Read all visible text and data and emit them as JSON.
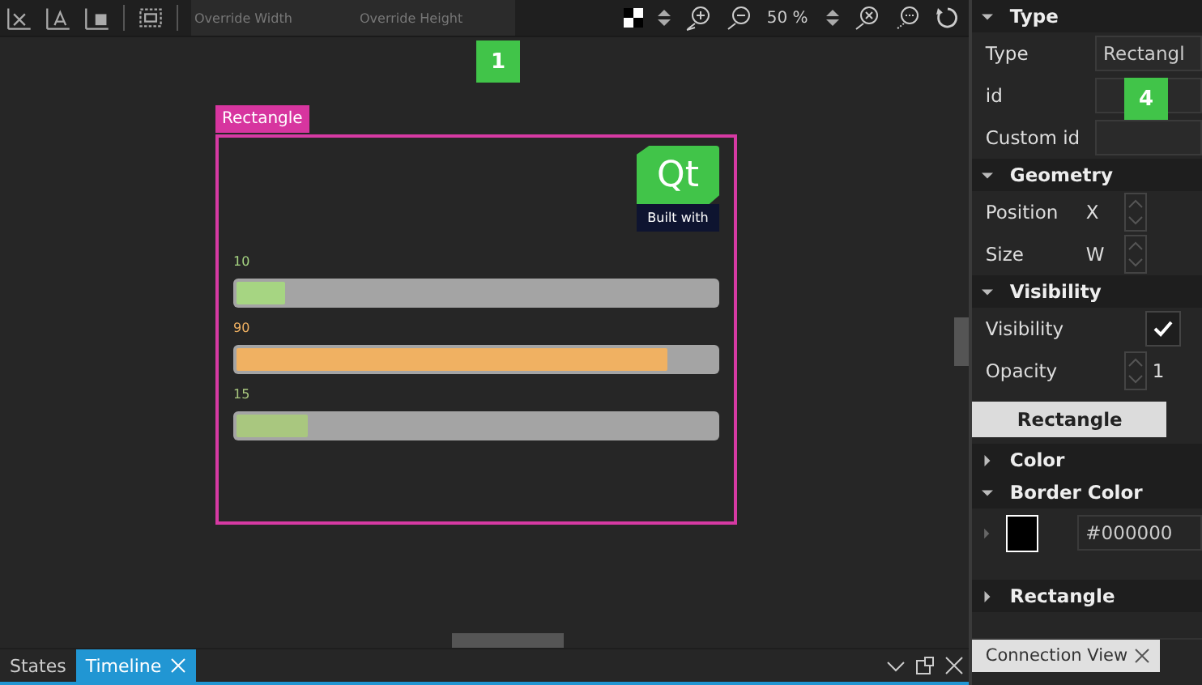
{
  "toolbar": {
    "width_field": {
      "placeholder": "Override Width"
    },
    "height_field": {
      "placeholder": "Override Height"
    },
    "zoom": "50 %"
  },
  "canvas": {
    "badge": "1",
    "item_label": "Rectangle",
    "logo": {
      "mark": "Qt",
      "caption": "Built with"
    },
    "bars": [
      {
        "value": "10",
        "level": 0.1,
        "color": "#a6d582"
      },
      {
        "value": "90",
        "level": 0.9,
        "color": "#f0b162"
      },
      {
        "value": "15",
        "level": 0.15,
        "color": "#a9c77f"
      }
    ]
  },
  "bottom_tabs": [
    {
      "label": "States",
      "selected": false,
      "closable": false
    },
    {
      "label": "Timeline",
      "selected": true,
      "closable": true
    }
  ],
  "properties": {
    "items": [
      {
        "kind": "section",
        "label": "Type",
        "expanded": true
      },
      {
        "kind": "field",
        "label": "Type",
        "value": "Rectangl"
      },
      {
        "kind": "field",
        "label": "id",
        "badge": "4"
      },
      {
        "kind": "field",
        "label": "Custom id"
      },
      {
        "kind": "section",
        "label": "Geometry",
        "expanded": true
      },
      {
        "kind": "spin",
        "label": "Position",
        "axis": "X"
      },
      {
        "kind": "spin",
        "label": "Size",
        "axis": "W"
      },
      {
        "kind": "section",
        "label": "Visibility",
        "expanded": true
      },
      {
        "kind": "check",
        "label": "Visibility",
        "checked": true
      },
      {
        "kind": "spin",
        "label": "Opacity",
        "value": "1"
      },
      {
        "kind": "tab",
        "label": "Rectangle",
        "selected": true
      },
      {
        "kind": "section",
        "label": "Color",
        "expanded": false
      },
      {
        "kind": "section",
        "label": "Border Color",
        "expanded": true
      },
      {
        "kind": "color",
        "color": "#000000",
        "value": "#000000"
      },
      {
        "kind": "section",
        "label": "Rectangle",
        "expanded": false
      }
    ]
  },
  "connection_tab": {
    "label": "Connection View"
  }
}
